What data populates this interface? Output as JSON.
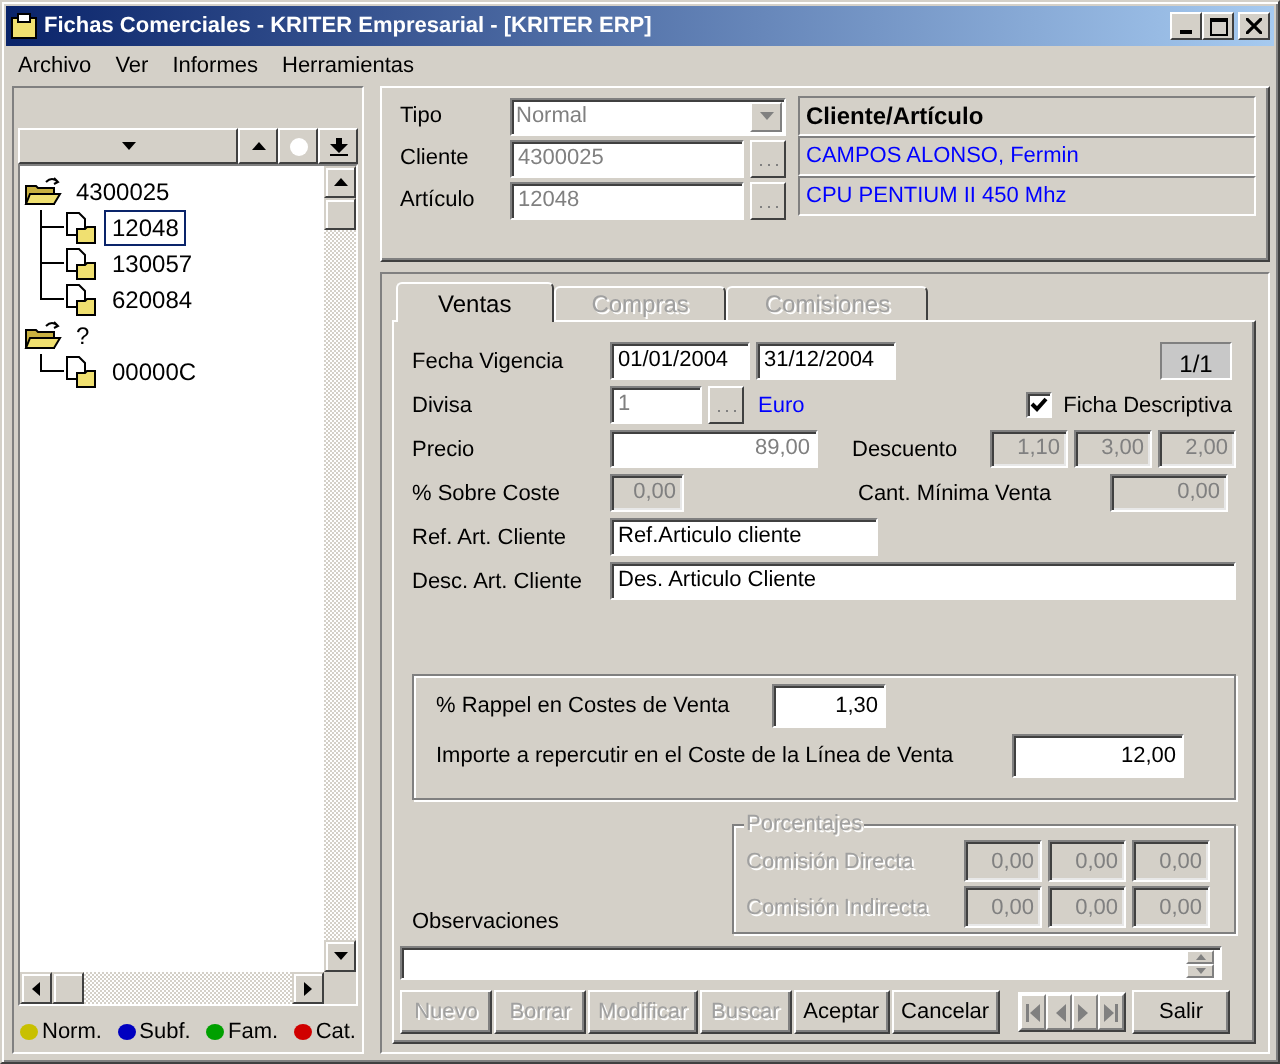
{
  "window": {
    "title": "Fichas Comerciales - KRITER Empresarial -  [KRITER ERP]"
  },
  "menu": [
    "Archivo",
    "Ver",
    "Informes",
    "Herramientas"
  ],
  "tree": {
    "nodes": [
      {
        "label": "4300025",
        "expanded": true,
        "selected": false,
        "children": [
          {
            "label": "12048",
            "selected": true
          },
          {
            "label": "130057",
            "selected": false
          },
          {
            "label": "620084",
            "selected": false
          }
        ]
      },
      {
        "label": "?",
        "expanded": true,
        "selected": false,
        "children": [
          {
            "label": "00000C",
            "selected": false
          }
        ]
      }
    ],
    "legend": [
      {
        "label": "Norm.",
        "color": "#c8c000"
      },
      {
        "label": "Subf.",
        "color": "#0000c0"
      },
      {
        "label": "Fam.",
        "color": "#00a000"
      },
      {
        "label": "Cat.",
        "color": "#d00000"
      }
    ]
  },
  "header": {
    "fields": [
      {
        "kind": "dropdown",
        "label": "Tipo",
        "value": "Normal",
        "disabled": true
      },
      {
        "kind": "lookup",
        "label": "Cliente",
        "value": "4300025",
        "disabled": true
      },
      {
        "kind": "lookup",
        "label": "Artículo",
        "value": "12048",
        "disabled": true
      }
    ],
    "info_title": "Cliente/Artículo",
    "info_lines": [
      "CAMPOS ALONSO, Fermin",
      "CPU PENTIUM II 450 Mhz"
    ]
  },
  "tabs": [
    {
      "label": "Ventas",
      "selected": true,
      "disabled": false
    },
    {
      "label": "Compras",
      "selected": false,
      "disabled": true
    },
    {
      "label": "Comisiones",
      "selected": false,
      "disabled": true
    }
  ],
  "ventas": {
    "fecha_vigencia": {
      "label": "Fecha Vigencia",
      "from": "01/01/2004",
      "to": "31/12/2004",
      "disabled": false
    },
    "record_counter": "1/1",
    "divisa": {
      "label": "Divisa",
      "value": "1",
      "name": "Euro",
      "disabled": true
    },
    "ficha_descriptiva": {
      "label": "Ficha Descriptiva",
      "checked": true
    },
    "precio": {
      "label": "Precio",
      "value": "89,00",
      "disabled": true
    },
    "descuento": {
      "label": "Descuento",
      "values": [
        "1,10",
        "3,00",
        "2,00"
      ],
      "disabled": true
    },
    "sobre_coste": {
      "label": "% Sobre Coste",
      "value": "0,00",
      "disabled": true
    },
    "cant_minima": {
      "label": "Cant. Mínima Venta",
      "value": "0,00",
      "disabled": true
    },
    "ref_art": {
      "label": "Ref. Art. Cliente",
      "value": "Ref.Articulo cliente",
      "disabled": false
    },
    "desc_art": {
      "label": "Desc. Art. Cliente",
      "value": "Des. Articulo Cliente",
      "disabled": false
    },
    "rappel": {
      "label": "% Rappel en Costes de Venta",
      "value": "1,30",
      "disabled": false
    },
    "importe": {
      "label": "Importe a repercutir en el Coste de la Línea de Venta",
      "value": "12,00",
      "disabled": false
    },
    "porcentajes": {
      "title": "Porcentajes",
      "disabled": true,
      "rows": [
        {
          "label": "Comisión Directa",
          "values": [
            "0,00",
            "0,00",
            "0,00"
          ]
        },
        {
          "label": "Comisión Indirecta",
          "values": [
            "0,00",
            "0,00",
            "0,00"
          ]
        }
      ]
    },
    "observaciones": {
      "label": "Observaciones"
    }
  },
  "buttons": [
    {
      "label": "Nuevo",
      "disabled": true
    },
    {
      "label": "Borrar",
      "disabled": true
    },
    {
      "label": "Modificar",
      "disabled": true
    },
    {
      "label": "Buscar",
      "disabled": true
    },
    {
      "label": "Aceptar",
      "disabled": false
    },
    {
      "label": "Cancelar",
      "disabled": false
    }
  ],
  "exit_button": {
    "label": "Salir",
    "disabled": false
  }
}
